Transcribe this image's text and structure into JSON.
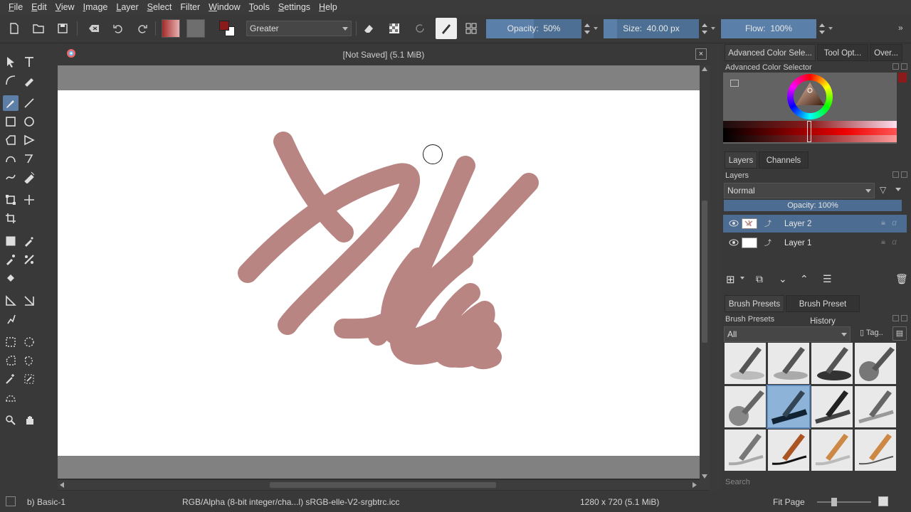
{
  "menubar": {
    "items": [
      {
        "label": "File",
        "u": "F",
        "rest": "ile"
      },
      {
        "label": "Edit",
        "u": "E",
        "rest": "dit"
      },
      {
        "label": "View",
        "u": "V",
        "rest": "iew"
      },
      {
        "label": "Image",
        "u": "I",
        "rest": "mage"
      },
      {
        "label": "Layer",
        "u": "L",
        "rest": "ayer"
      },
      {
        "label": "Select",
        "u": "S",
        "rest": "elect"
      },
      {
        "label": "Filter",
        "u": "",
        "rest": "Filter"
      },
      {
        "label": "Window",
        "u": "W",
        "rest": "indow"
      },
      {
        "label": "Tools",
        "u": "T",
        "rest": "ools"
      },
      {
        "label": "Settings",
        "u": "S",
        "rest": "ettings"
      },
      {
        "label": "Help",
        "u": "H",
        "rest": "elp"
      }
    ]
  },
  "toolbar": {
    "blend_mode": "Greater",
    "opacity_label": "Opacity:",
    "opacity_value": "50%",
    "opacity_fraction": 0.5,
    "size_label": "Size:",
    "size_value": "40.00 px",
    "flow_label": "Flow:",
    "flow_value": "100%",
    "flow_fraction": 1.0,
    "foreground_color": "#8b1a1a",
    "background_color": "#ffffff"
  },
  "document": {
    "title": "[Not Saved]  (5.1 MiB)",
    "close": "×",
    "stroke_color": "#b98583"
  },
  "dock": {
    "tabs": [
      "Advanced Color Sele...",
      "Tool Opt...",
      "Over..."
    ],
    "color_selector_title": "Advanced Color Selector",
    "layer_tabs": [
      "Layers",
      "Channels"
    ],
    "layers_title": "Layers",
    "blend_mode": "Normal",
    "layer_opacity": "Opacity:  100%",
    "layers": [
      {
        "name": "Layer 2",
        "selected": true
      },
      {
        "name": "Layer 1",
        "selected": false
      }
    ],
    "preset_tabs": [
      "Brush Presets",
      "Brush Preset History"
    ],
    "presets_title": "Brush Presets",
    "preset_filter": "All",
    "tag_label": "Tag",
    "search_placeholder": "Search"
  },
  "statusbar": {
    "preset": "b) Basic-1",
    "color_info": "RGB/Alpha (8-bit integer/cha...l)  sRGB-elle-V2-srgbtrc.icc",
    "dimensions": "1280 x 720 (5.1 MiB)",
    "zoom": "Fit Page"
  }
}
